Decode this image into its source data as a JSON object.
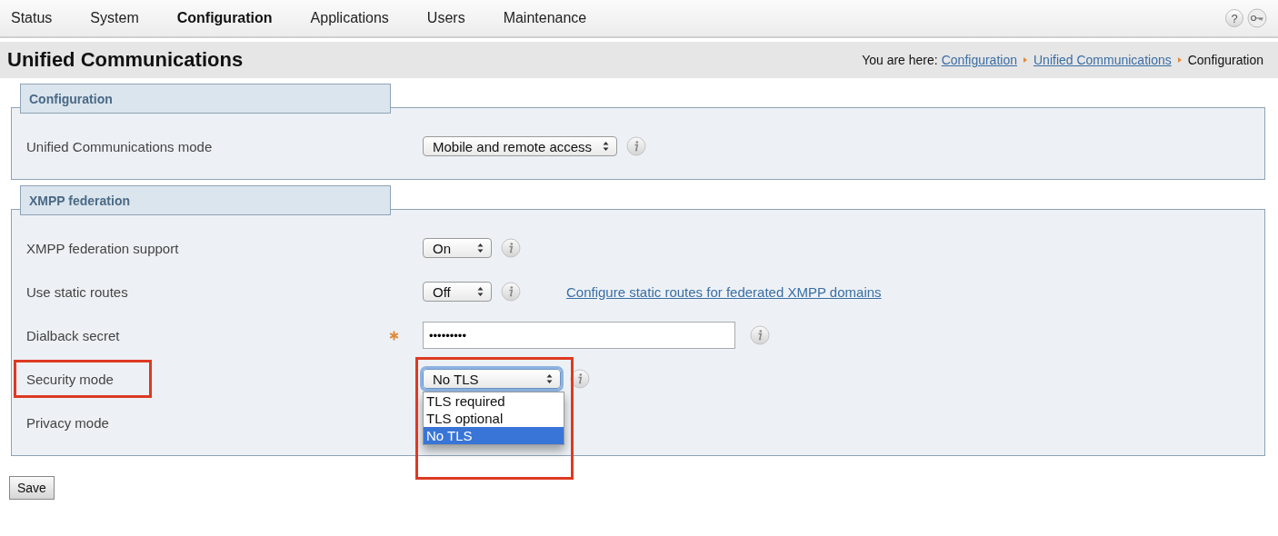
{
  "nav": {
    "items": [
      {
        "label": "Status",
        "selected": false
      },
      {
        "label": "System",
        "selected": false
      },
      {
        "label": "Configuration",
        "selected": true
      },
      {
        "label": "Applications",
        "selected": false
      },
      {
        "label": "Users",
        "selected": false
      },
      {
        "label": "Maintenance",
        "selected": false
      }
    ],
    "help_label": "?"
  },
  "page": {
    "title": "Unified Communications",
    "breadcrumb": {
      "prefix": "You are here:",
      "links": [
        "Configuration",
        "Unified Communications"
      ],
      "current": "Configuration"
    }
  },
  "sections": [
    {
      "title": "Configuration",
      "rows": [
        {
          "label": "Unified Communications mode",
          "kind": "select",
          "value": "Mobile and remote access"
        }
      ]
    },
    {
      "title": "XMPP federation",
      "rows": [
        {
          "label": "XMPP federation support",
          "kind": "select",
          "value": "On"
        },
        {
          "label": "Use static routes",
          "kind": "select",
          "value": "Off",
          "link": "Configure static routes for federated XMPP domains"
        },
        {
          "label": "Dialback secret",
          "kind": "password",
          "value": "•••••••••",
          "required": true
        },
        {
          "label": "Security mode",
          "kind": "select",
          "value": "No TLS",
          "focused": true,
          "label_highlighted": true,
          "control_highlighted": true,
          "dropdown": [
            {
              "label": "TLS required",
              "selected": false
            },
            {
              "label": "TLS optional",
              "selected": false
            },
            {
              "label": "No TLS",
              "selected": true
            }
          ]
        },
        {
          "label": "Privacy mode",
          "kind": "covered"
        }
      ]
    }
  ],
  "save": {
    "label": "Save"
  }
}
